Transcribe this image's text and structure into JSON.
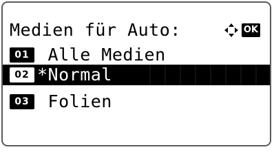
{
  "title": "Medien für Auto:",
  "nav": {
    "arrows_icon": "four-way-arrows-icon",
    "ok_label": "OK"
  },
  "items": [
    {
      "number": "01",
      "label": " Alle Medien",
      "selected": false
    },
    {
      "number": "02",
      "label": "*Normal",
      "selected": true
    },
    {
      "number": "03",
      "label": " Folien",
      "selected": false
    }
  ],
  "colors": {
    "background": "#ffffff",
    "foreground": "#000000",
    "frame": "#5a5a5a"
  }
}
